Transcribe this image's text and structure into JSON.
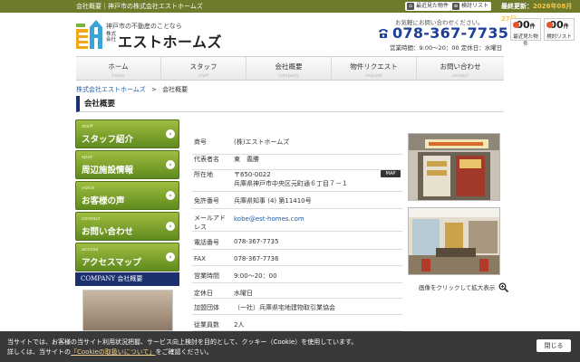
{
  "topbar": {
    "tagline": "会社概要｜神戸市の株式会社エストホームズ",
    "recent_label": "最近見た物件",
    "saved_label": "検討リスト",
    "updated_label": "最終更新：",
    "updated_date": "2026年08月27日"
  },
  "header": {
    "logo_tagline": "神戸市の不動産のことなら",
    "logo_kk": "株式会社",
    "logo_name": "エストホームズ",
    "contact_prompt": "お気軽にお問い合わせください。",
    "phone": "078-367-7735",
    "hours": "営業時間：9:00～20：00 定休日：水曜日",
    "counters": [
      {
        "count": "00",
        "unit": "件",
        "label": "最近見た物件"
      },
      {
        "count": "00",
        "unit": "件",
        "label": "検討リスト"
      }
    ]
  },
  "nav": [
    {
      "ja": "ホーム",
      "en": "home"
    },
    {
      "ja": "スタッフ",
      "en": "staff"
    },
    {
      "ja": "会社概要",
      "en": "company"
    },
    {
      "ja": "物件リクエスト",
      "en": "request"
    },
    {
      "ja": "お問い合わせ",
      "en": "contact"
    }
  ],
  "breadcrumb": {
    "home": "株式会社エストホームズ",
    "sep": ">",
    "current": "会社概要"
  },
  "page_title": "会社概要",
  "side_menu": [
    {
      "en": "staff",
      "ja": "スタッフ紹介"
    },
    {
      "en": "spot",
      "ja": "周辺施設情報"
    },
    {
      "en": "voice",
      "ja": "お客様の声"
    },
    {
      "en": "contact",
      "ja": "お問い合わせ"
    },
    {
      "en": "access",
      "ja": "アクセスマップ"
    }
  ],
  "company_box_label": "COMPANY 会社概要",
  "company_table": [
    {
      "key": "商号",
      "value": "(株)エストホームズ"
    },
    {
      "key": "代表者名",
      "value": "東　義勝"
    },
    {
      "key": "所在地",
      "value": "〒650-0022",
      "value2": "兵庫県神戸市中央区元町通６丁目７－１",
      "map": "MAP"
    },
    {
      "key": "免許番号",
      "value": "兵庫県知事 (4) 第11410号"
    },
    {
      "key": "メールアドレス",
      "value": "kobe@est-homes.com"
    },
    {
      "key": "電話番号",
      "value": "078-367-7735"
    },
    {
      "key": "FAX",
      "value": "078-367-7736"
    },
    {
      "key": "営業時間",
      "value": "9:00～20：00"
    },
    {
      "key": "定休日",
      "value": "水曜日"
    },
    {
      "key": "加盟団体",
      "value": "（一社）兵庫県宅地建物取引業協会"
    },
    {
      "key": "従業員数",
      "value": "2人"
    }
  ],
  "photo_caption": "画像をクリックして拡大表示",
  "cookie": {
    "line1": "当サイトでは、お客様の当サイト利用状況把握、サービス向上検討を目的として、クッキー（Cookie）を使用しています。",
    "line2_pre": "詳しくは、当サイトの",
    "line2_link": "「Cookieの取扱いについて」",
    "line2_post": "をご確認ください。",
    "close_label": "閉じる"
  },
  "colors": {
    "accent_green": "#6f7a2a",
    "menu_green": "#7aa12c",
    "navy": "#1c2f6e",
    "phone_blue": "#1c3f99"
  }
}
